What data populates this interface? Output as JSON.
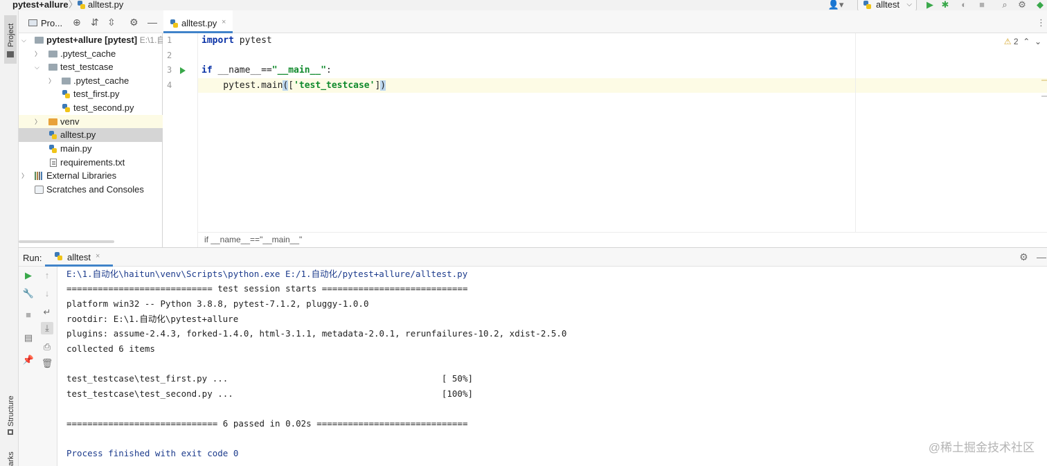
{
  "window": {
    "project_crumb": "pytest+allure",
    "separator": "〉",
    "file_crumb": "alltest.py",
    "run_config": "alltest"
  },
  "toolbar_icons": [
    "user-icon",
    "run-icon",
    "debug-icon",
    "coverage-icon",
    "stop-icon",
    "search-icon",
    "settings-icon",
    "plugin-icon"
  ],
  "stripe": {
    "project_label": "Project",
    "structure_label": "Structure",
    "bookmarks_label": "arks"
  },
  "project_panel": {
    "title": "Pro...",
    "tree": [
      {
        "label": "pytest+allure [pytest]",
        "extra": "E:\\1.自",
        "kind": "folder",
        "expanded": true
      },
      {
        "label": ".pytest_cache",
        "kind": "folder",
        "expanded": false
      },
      {
        "label": "test_testcase",
        "kind": "folder",
        "expanded": true
      },
      {
        "label": ".pytest_cache",
        "kind": "folder",
        "expanded": false
      },
      {
        "label": "test_first.py",
        "kind": "python"
      },
      {
        "label": "test_second.py",
        "kind": "python"
      },
      {
        "label": "venv",
        "kind": "folder-orange",
        "expanded": false
      },
      {
        "label": "alltest.py",
        "kind": "python",
        "selected": true
      },
      {
        "label": "main.py",
        "kind": "python"
      },
      {
        "label": "requirements.txt",
        "kind": "text"
      },
      {
        "label": "External Libraries",
        "kind": "library",
        "expanded": false
      },
      {
        "label": "Scratches and Consoles",
        "kind": "scratch"
      }
    ]
  },
  "editor": {
    "tab_label": "alltest.py",
    "tab_close": "×",
    "line_numbers": [
      "1",
      "2",
      "3",
      "4"
    ],
    "code": {
      "l1_kw": "import",
      "l1_rest": " pytest",
      "l3_kw": "if",
      "l3_mid": " __name__==",
      "l3_str": "\"__main__\"",
      "l3_end": ":",
      "l4_pre": "    pytest.main",
      "l4_open": "(",
      "l4_mid": "[",
      "l4_str": "'test_testcase'",
      "l4_mid2": "]",
      "l4_close": ")"
    },
    "warning_count": "2",
    "breadcrumb": "if __name__==\"__main__\""
  },
  "run_panel": {
    "title": "Run:",
    "tab_label": "alltest",
    "tab_close": "×",
    "console": [
      "E:\\1.自动化\\haitun\\venv\\Scripts\\python.exe E:/1.自动化/pytest+allure/alltest.py",
      "============================ test session starts ============================",
      "platform win32 -- Python 3.8.8, pytest-7.1.2, pluggy-1.0.0",
      "rootdir: E:\\1.自动化\\pytest+allure",
      "plugins: assume-2.4.3, forked-1.4.0, html-3.1.1, metadata-2.0.1, rerunfailures-10.2, xdist-2.5.0",
      "collected 6 items",
      "",
      "test_testcase\\test_first.py ...                                         [ 50%]",
      "test_testcase\\test_second.py ...                                        [100%]",
      "",
      "============================= 6 passed in 0.02s =============================",
      "",
      "Process finished with exit code 0"
    ]
  },
  "watermark": "@稀土掘金技术社区",
  "colors": {
    "accent": "#4083c9",
    "keyword": "#0a32a6",
    "string": "#108a2c",
    "run_green": "#39a84a",
    "console_blue": "#1c3b8c"
  }
}
